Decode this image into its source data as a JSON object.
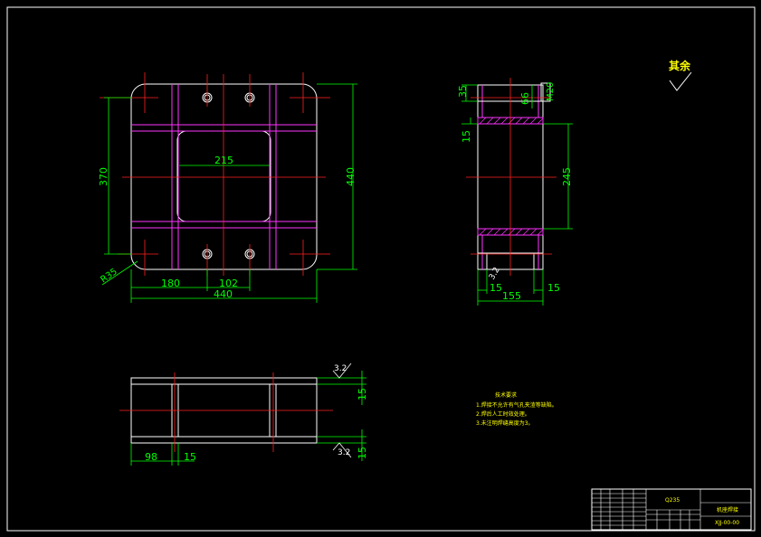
{
  "colors": {
    "background": "#000000",
    "outline": "#ffffff",
    "centerline": "#ff2020",
    "dimension": "#00ff00",
    "hatch": "#ff33ff",
    "note_text": "#ffff00"
  },
  "front_view": {
    "dim_215": "215",
    "dim_370": "370",
    "dim_440_vertical": "440",
    "dim_180": "180",
    "dim_102": "102",
    "dim_440_horizontal": "440",
    "dim_r35": "R35"
  },
  "side_view": {
    "dim_35": "35",
    "dim_66": "66",
    "dim_m20": "M20",
    "dim_15_top": "15",
    "dim_245": "245",
    "dim_3_2": "3.2",
    "dim_15_bottom_left": "15",
    "dim_155": "155",
    "dim_15_bottom_right": "15"
  },
  "top_view": {
    "roughness_top": "3.2",
    "dim_15_top": "15",
    "roughness_bottom": "3.2",
    "dim_15_bottom": "15",
    "dim_98": "98",
    "dim_15_horizontal": "15"
  },
  "surface_finish": {
    "label": "其余"
  },
  "technical_requirements": {
    "title": "技术要求",
    "items": [
      "1.焊接不允许有气孔夹渣等缺陷。",
      "2.焊后人工时效处理。",
      "3.未注明焊缝高度为3。"
    ]
  },
  "title_block": {
    "material": "Q235",
    "part_name": "机座焊接",
    "drawing_number": "XJJ-00-00"
  }
}
